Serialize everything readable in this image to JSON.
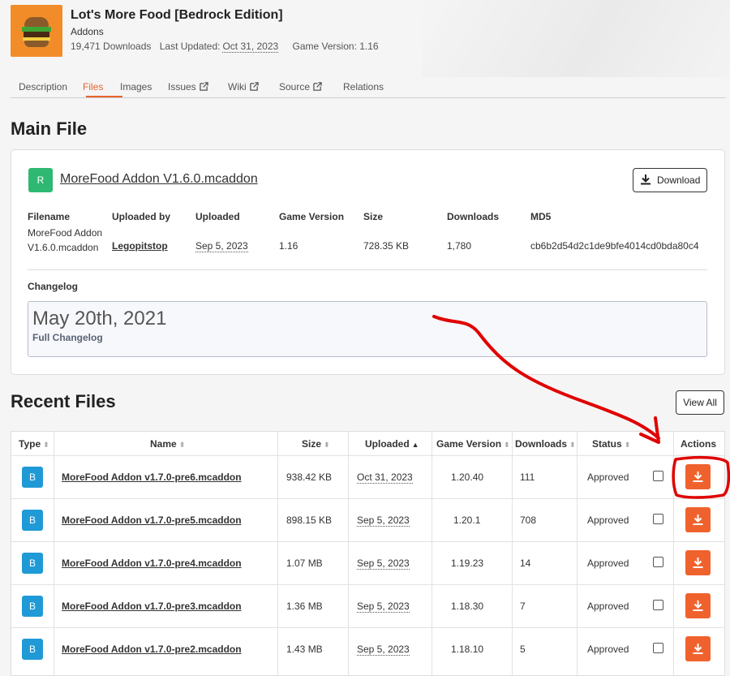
{
  "project": {
    "title": "Lot's More Food [Bedrock Edition]",
    "category": "Addons",
    "downloads": "19,471 Downloads",
    "last_updated_label": "Last Updated:",
    "last_updated_value": "Oct 31, 2023",
    "game_version": "Game Version: 1.16"
  },
  "tabs": [
    {
      "label": "Description"
    },
    {
      "label": "Files",
      "active": true
    },
    {
      "label": "Images"
    },
    {
      "label": "Issues",
      "external": true
    },
    {
      "label": "Wiki",
      "external": true
    },
    {
      "label": "Source",
      "external": true
    },
    {
      "label": "Relations"
    }
  ],
  "main_file": {
    "heading": "Main File",
    "badge": "R",
    "name": "MoreFood Addon V1.6.0.mcaddon",
    "download_label": "Download",
    "headers": {
      "filename": "Filename",
      "uploaded_by": "Uploaded by",
      "uploaded": "Uploaded",
      "game_version": "Game Version",
      "size": "Size",
      "downloads": "Downloads",
      "md5": "MD5"
    },
    "values": {
      "filename_line1": "MoreFood Addon",
      "filename_line2": "V1.6.0.mcaddon",
      "uploaded_by": "Legopitstop",
      "uploaded": "Sep 5, 2023",
      "game_version": "1.16",
      "size": "728.35 KB",
      "downloads": "1,780",
      "md5": "cb6b2d54d2c1de9bfe4014cd0bda80c4"
    },
    "changelog_label": "Changelog",
    "changelog_date": "May 20th, 2021",
    "changelog_link": "Full Changelog"
  },
  "recent": {
    "heading": "Recent Files",
    "view_all": "View All",
    "columns": {
      "type": "Type",
      "name": "Name",
      "size": "Size",
      "uploaded": "Uploaded",
      "game_version": "Game Version",
      "downloads": "Downloads",
      "status": "Status",
      "actions": "Actions"
    },
    "rows": [
      {
        "type": "B",
        "name": "MoreFood Addon v1.7.0-pre6.mcaddon",
        "size": "938.42 KB",
        "uploaded": "Oct 31, 2023",
        "game_version": "1.20.40",
        "downloads": "111",
        "status": "Approved"
      },
      {
        "type": "B",
        "name": "MoreFood Addon v1.7.0-pre5.mcaddon",
        "size": "898.15 KB",
        "uploaded": "Sep 5, 2023",
        "game_version": "1.20.1",
        "downloads": "708",
        "status": "Approved"
      },
      {
        "type": "B",
        "name": "MoreFood Addon v1.7.0-pre4.mcaddon",
        "size": "1.07 MB",
        "uploaded": "Sep 5, 2023",
        "game_version": "1.19.23",
        "downloads": "14",
        "status": "Approved"
      },
      {
        "type": "B",
        "name": "MoreFood Addon v1.7.0-pre3.mcaddon",
        "size": "1.36 MB",
        "uploaded": "Sep 5, 2023",
        "game_version": "1.18.30",
        "downloads": "7",
        "status": "Approved"
      },
      {
        "type": "B",
        "name": "MoreFood Addon v1.7.0-pre2.mcaddon",
        "size": "1.43 MB",
        "uploaded": "Sep 5, 2023",
        "game_version": "1.18.10",
        "downloads": "5",
        "status": "Approved"
      }
    ]
  },
  "colors": {
    "accent": "#e8642c",
    "download_button": "#f0622d",
    "release_badge": "#2eb872",
    "beta_badge": "#1f9ad6",
    "annotation": "#e00000"
  },
  "icons": [
    "burger-logo-icon",
    "external-link-icon",
    "download-icon",
    "sort-icon",
    "sort-up-icon"
  ]
}
